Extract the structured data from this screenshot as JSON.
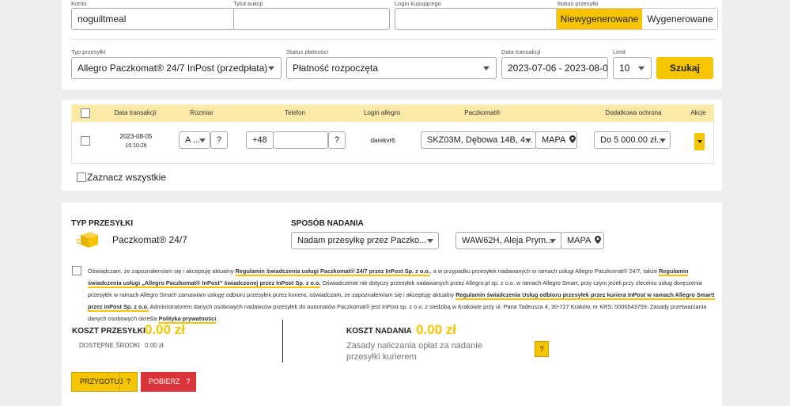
{
  "filters": {
    "konto_label": "Konto",
    "konto_value": "noguiltmeal",
    "tytul_label": "Tytuł aukcji",
    "login_label": "Login kupującego",
    "status_przesylki_label": "Status przesyłki",
    "toggle_left": "Niewygenerowane",
    "toggle_right": "Wygenerowane",
    "typ_label": "Typ przesyłki",
    "typ_value": "Allegro Paczkomat® 24/7 InPost (przedpłata)",
    "status_platnosci_label": "Status płatności",
    "status_platnosci_value": "Płatność rozpoczęta",
    "data_label": "Data transakcji",
    "data_value": "2023-07-06 - 2023-08-05",
    "limit_label": "Limit",
    "limit_value": "10",
    "search_button": "Szukaj"
  },
  "table": {
    "headers": [
      "Data transakcji",
      "Rozmiar",
      "Telefon",
      "Login allegro",
      "Paczkomat®",
      "Dodatkowa ochrona",
      "Akcje"
    ],
    "row": {
      "date": "2023-08-05",
      "time": "15:10:26",
      "size": "A ...",
      "size_help": "?",
      "phone_prefix": "+48",
      "phone_help": "?",
      "login": "darekvr6",
      "paczkomat": "SKZ03M, Dębowa 14B, 4...",
      "map": "MAPA",
      "protection": "Do 5 000.00 zł...",
      "action_icon": "caret-down"
    },
    "select_all": "Zaznacz wszystkie"
  },
  "shipping": {
    "typ_heading": "TYP PRZESYŁKI",
    "typ_name": "Paczkomat® 24/7",
    "sposob_heading": "SPOSÓB NADANIA",
    "sposob_value": "Nadam przesyłkę przez Paczko...",
    "point_value": "WAW62H, Aleja Prym...",
    "map": "MAPA"
  },
  "consent": {
    "t1": "Oświadczam, że zapoznałem/am się i akceptuję aktualny ",
    "l1": "Regulamin świadczenia usługi Paczkomat® 24/7 przez InPost Sp. z o.o.",
    "t2": ", a w przypadku przesyłek nadawanych w ramach usługi Allegro Paczkomat® 24/7, także ",
    "l2": "Regulamin świadczenia usługi „Allegro Paczkomat® InPost” świadczonej przez InPost Sp. z o.o.",
    "t3": " Oświadczenie nie dotyczy przesyłek nadawanych przez Allegro.pl sp. z o.o. w ramach Allegro Smart, przy czym jeżeli przy zleceniu usług doręczenia przesyłek w ramach Allegro Smart! zamawiam usługę odbioru przesyłek przez kuriera, oświadczam, że zapoznałem/am się i akceptuję aktualny ",
    "l3": "Regulamin świadczenia Usług odbioru przesyłek przez kuriera InPost w ramach Allegro Smart! przez InPost Sp. z o.o.",
    "t4": " Administratorem danych osobowych nadawców przesyłek do automatów Paczkomat® jest InPost sp. z o.o. z siedzibą w Krakowie przy ul. Pana Tadeusza 4, 30-727 Kraków, nr KRS: 0000543759. Zasady przetwarzania danych osobowych określa ",
    "l4": "Polityka prywatności",
    "t5": "."
  },
  "costs": {
    "koszt_przesylki_label": "KOSZT PRZESYŁKI",
    "koszt_przesylki_value": "0.00 zł",
    "dostepne_label": "DOSTĘPNE ŚRODKI",
    "dostepne_value": "0.00 zł",
    "koszt_nadania_label": "KOSZT NADANIA",
    "koszt_nadania_value": "0.00 zł",
    "zasady_text": "Zasady naliczania opłat za nadanie przesyłki kurierem",
    "help": "?"
  },
  "actions": {
    "prepare": "PRZYGOTUJ",
    "prepare_help": "?",
    "download": "POBIERZ",
    "download_help": "?"
  },
  "colors": {
    "accent": "#f7c400",
    "danger": "#d9343a"
  }
}
